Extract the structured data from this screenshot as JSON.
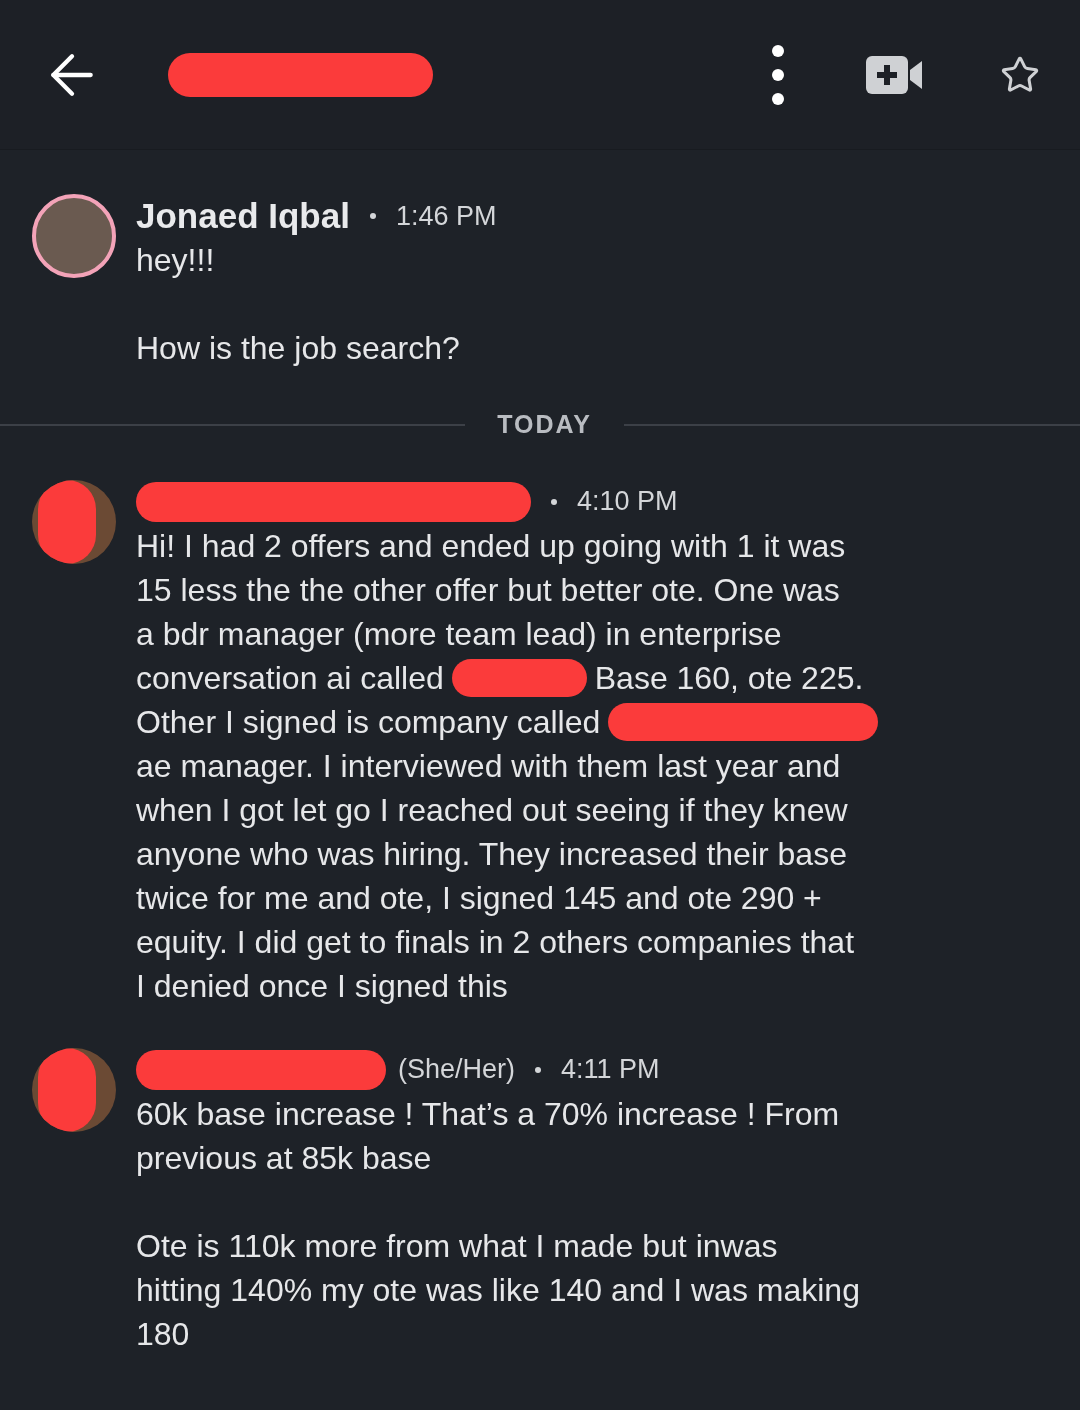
{
  "header": {
    "title_redacted": true
  },
  "messages": [
    {
      "name": "Jonaed Iqbal",
      "name_redacted": false,
      "avatar_redacted": false,
      "time": "1:46 PM",
      "paragraphs": [
        [
          [
            {
              "kind": "text",
              "text": "hey!!!"
            }
          ]
        ],
        [
          [
            {
              "kind": "text",
              "text": "How is the job search?"
            }
          ]
        ]
      ]
    },
    {
      "divider": "TODAY",
      "name_redacted": true,
      "avatar_redacted": true,
      "time": "4:10 PM",
      "paragraphs": [
        [
          [
            {
              "kind": "text",
              "text": "Hi! I had 2 offers and ended up going with 1 it was"
            }
          ],
          [
            {
              "kind": "text",
              "text": "15 less the the other offer but better ote. One was"
            }
          ],
          [
            {
              "kind": "text",
              "text": "a bdr manager (more team lead) in enterprise"
            }
          ],
          [
            {
              "kind": "text",
              "text": "conversation ai called"
            },
            {
              "kind": "redaction"
            },
            {
              "kind": "text",
              "text": "Base 160, ote 225."
            }
          ],
          [
            {
              "kind": "text",
              "text": "Other I signed is company called"
            },
            {
              "kind": "redaction"
            }
          ],
          [
            {
              "kind": "text",
              "text": "ae manager. I interviewed with them last year and"
            }
          ],
          [
            {
              "kind": "text",
              "text": "when I got let go I reached out seeing if they knew"
            }
          ],
          [
            {
              "kind": "text",
              "text": "anyone who was hiring. They increased their base"
            }
          ],
          [
            {
              "kind": "text",
              "text": "twice for me and ote, I signed 145 and ote 290 +"
            }
          ],
          [
            {
              "kind": "text",
              "text": "equity. I did get to finals in 2 others companies that"
            }
          ],
          [
            {
              "kind": "text",
              "text": "I denied once I signed this"
            }
          ]
        ]
      ]
    },
    {
      "name_redacted": true,
      "avatar_redacted": true,
      "pronouns": "(She/Her)",
      "time": "4:11 PM",
      "paragraphs": [
        [
          [
            {
              "kind": "text",
              "text": "60k base increase ! That’s a 70% increase ! From"
            }
          ],
          [
            {
              "kind": "text",
              "text": "previous at 85k base"
            }
          ]
        ],
        [
          [
            {
              "kind": "text",
              "text": "Ote is 110k more from what I made but inwas"
            }
          ],
          [
            {
              "kind": "text",
              "text": "hitting 140% my ote was like 140 and I was making"
            }
          ],
          [
            {
              "kind": "text",
              "text": "180"
            }
          ]
        ]
      ]
    }
  ]
}
